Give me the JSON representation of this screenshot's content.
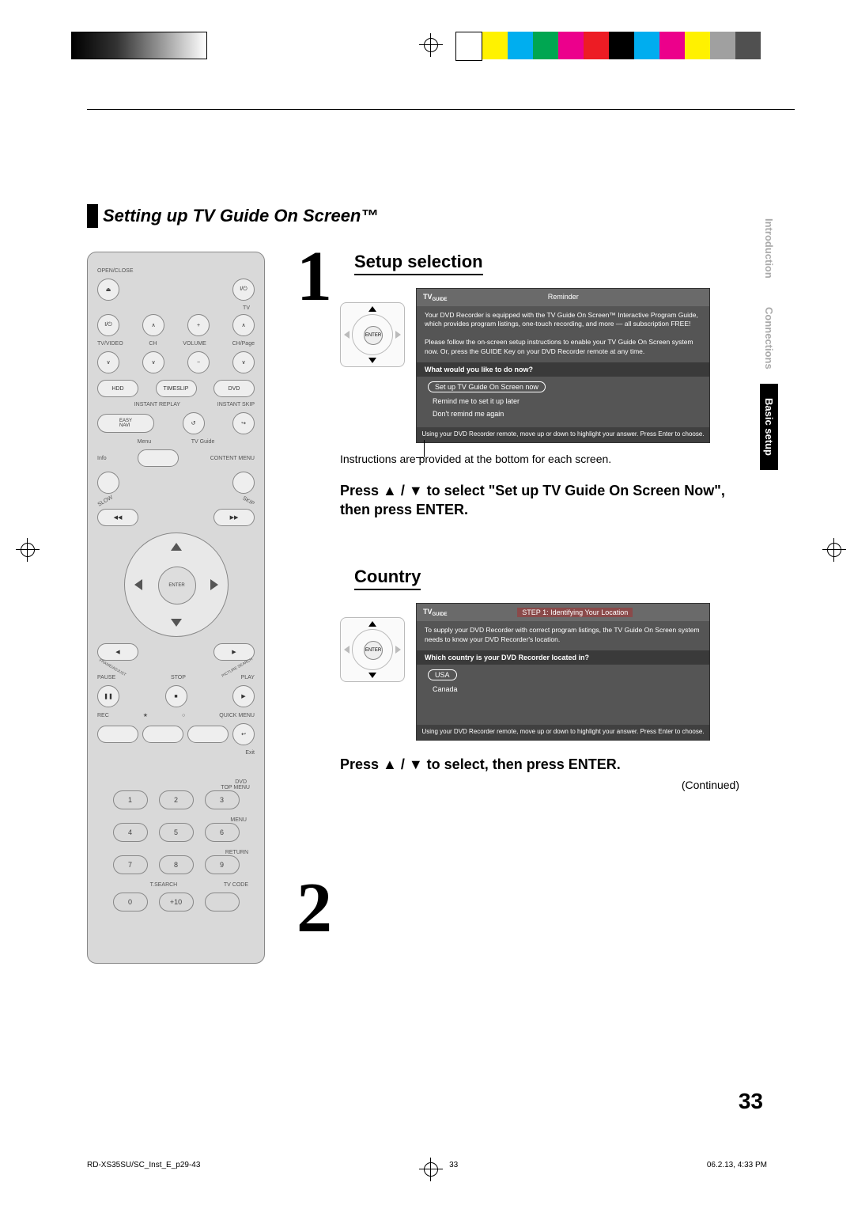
{
  "section_title": "Setting up TV Guide On Screen™",
  "sidetabs": {
    "intro": "Introduction",
    "conn": "Connections",
    "basic": "Basic setup"
  },
  "step1": {
    "heading": "Setup selection",
    "enter": "ENTER",
    "tv": {
      "logo": "TV",
      "logosub": "GUIDE",
      "reminder": "Reminder",
      "body": "Your DVD Recorder is equipped with the TV Guide On Screen™ Interactive Program Guide, which provides program listings, one-touch recording, and more — all subscription FREE!\n\nPlease follow the on-screen setup instructions to enable your TV Guide On Screen system now. Or, press the GUIDE Key on your DVD Recorder remote at any time.",
      "question": "What would you like to do now?",
      "opt1": "Set up TV Guide On Screen now",
      "opt2": "Remind me to set it up later",
      "opt3": "Don't remind me again",
      "foot": "Using your DVD Recorder remote, move up or down to highlight your answer. Press Enter to choose."
    },
    "note": "Instructions are provided at the bottom for each screen.",
    "instr": "Press ▲ / ▼ to select \"Set up TV Guide On Screen Now\", then press ENTER."
  },
  "step2": {
    "heading": "Country",
    "enter": "ENTER",
    "tv": {
      "logo": "TV",
      "logosub": "GUIDE",
      "stepbar": "STEP 1: Identifying Your Location",
      "body": "To supply your DVD Recorder with correct program listings, the TV Guide On Screen system needs to know your DVD Recorder's location.",
      "question": "Which country is your DVD Recorder located in?",
      "opt1": "USA",
      "opt2": "Canada",
      "foot": "Using your DVD Recorder remote, move up or down to highlight your answer. Press Enter to choose."
    },
    "instr": "Press ▲ / ▼ to select, then press ENTER.",
    "continued": "(Continued)"
  },
  "remote": {
    "openclose": "OPEN/CLOSE",
    "tv": "TV",
    "tvvideo": "TV/VIDEO",
    "ch": "CH",
    "volume": "VOLUME",
    "chpage": "CH/Page",
    "hdd": "HDD",
    "timeslip": "TIMESLIP",
    "dvd": "DVD",
    "easynavi": "EASY\nNAVI",
    "instreplay": "INSTANT REPLAY",
    "instskip": "INSTANT SKIP",
    "menu": "Menu",
    "tvguide": "TV Guide",
    "info": "Info",
    "contentmenu": "CONTENT MENU",
    "slow": "SLOW",
    "skip": "SKIP",
    "enter": "ENTER",
    "frameadjust": "FRAME/ADJUST",
    "picturesearch": "PICTURE SEARCH",
    "pause": "PAUSE",
    "stop": "STOP",
    "play": "PLAY",
    "rec": "REC",
    "quickmenu": "QUICK MENU",
    "exit": "Exit",
    "dvdtop": "DVD",
    "topmenu": "TOP MENU",
    "menub": "MENU",
    "return": "RETURN",
    "tsearch": "T.SEARCH",
    "tvcode": "TV CODE",
    "plus10": "+10",
    "nums": [
      "1",
      "2",
      "3",
      "4",
      "5",
      "6",
      "7",
      "8",
      "9",
      "0"
    ]
  },
  "pagenum": "33",
  "footer": {
    "left": "RD-XS35SU/SC_Inst_E_p29-43",
    "mid": "33",
    "right": "06.2.13, 4:33 PM"
  },
  "colors": [
    "#ffffff",
    "#fff200",
    "#00aeef",
    "#00a651",
    "#ec008c",
    "#ed1c24",
    "#000000",
    "#a0a0a0",
    "#505050",
    "#00adef",
    "#ec008b",
    "#fff100"
  ]
}
